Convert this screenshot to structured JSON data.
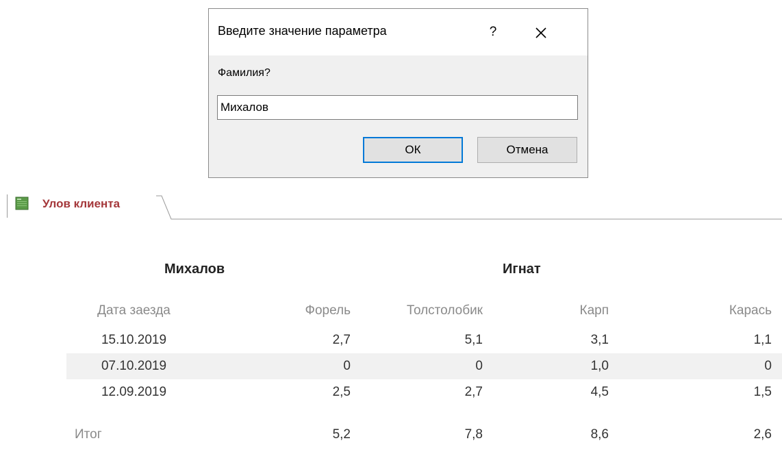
{
  "dialog": {
    "title": "Введите значение параметра",
    "help_label": "?",
    "prompt": "Фамилия?",
    "input_value": "Михалов",
    "ok_label": "ОК",
    "cancel_label": "Отмена"
  },
  "tab": {
    "label": "Улов клиента",
    "icon": "report-icon"
  },
  "report": {
    "surname": "Михалов",
    "first_name": "Игнат",
    "columns": [
      "Дата заезда",
      "Форель",
      "Толстолобик",
      "Карп",
      "Карась"
    ],
    "rows": [
      {
        "date": "15.10.2019",
        "trout": "2,7",
        "silver": "5,1",
        "carp": "3,1",
        "crucian": "1,1"
      },
      {
        "date": "07.10.2019",
        "trout": "0",
        "silver": "0",
        "carp": "1,0",
        "crucian": "0"
      },
      {
        "date": "12.09.2019",
        "trout": "2,5",
        "silver": "2,7",
        "carp": "4,5",
        "crucian": "1,5"
      }
    ],
    "total": {
      "label": "Итог",
      "trout": "5,2",
      "silver": "7,8",
      "carp": "8,6",
      "crucian": "2,6"
    }
  },
  "colors": {
    "tab_label": "#a4373a",
    "ok_focus": "#0078d7",
    "alt_row": "#f1f1f1"
  }
}
